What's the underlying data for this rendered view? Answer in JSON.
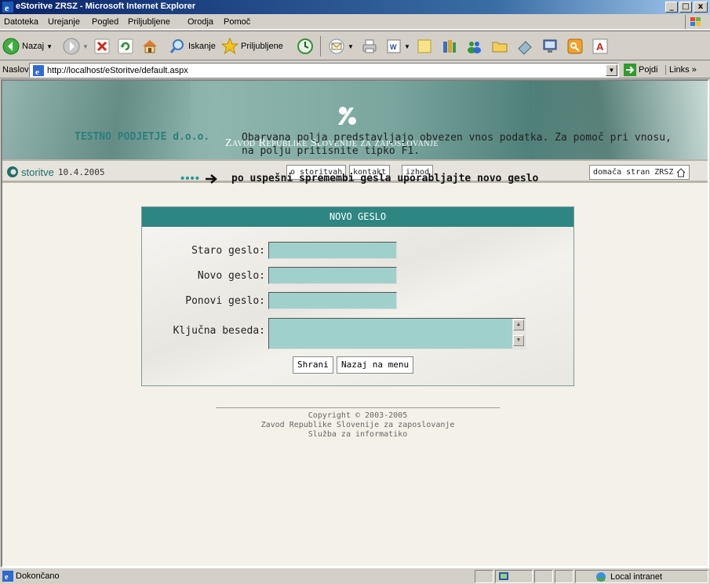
{
  "window": {
    "title": "eStoritve ZRSZ - Microsoft Internet Explorer",
    "controls": [
      "_",
      "□",
      "x"
    ]
  },
  "menu": [
    "Datoteka",
    "Urejanje",
    "Pogled",
    "Priljubljene",
    "Orodja",
    "Pomoč"
  ],
  "toolbar": {
    "back_label": "Nazaj",
    "search_label": "Iskanje",
    "favorites_label": "Priljubljene"
  },
  "address": {
    "label": "Naslov",
    "url": "http://localhost/eStoritve/default.aspx",
    "go_label": "Pojdi",
    "links_label": "Links »"
  },
  "banner": {
    "org": "Zavod Republike Slovenije za zaposlovanje"
  },
  "nav": {
    "brand": "storitve",
    "date": "10.4.2005",
    "links": [
      "o storitvah",
      "kontakt",
      "izhod"
    ],
    "home_link": "domača stran ZRSZ"
  },
  "page": {
    "company": "TESTNO PODJETJE d.o.o.",
    "instructions": "Obarvana polja predstavljajo obvezen vnos podatka. Za pomoč pri vnosu, na polju pritisnite tipko F1.",
    "tip_dots": "••••",
    "tip": "po uspešni spremembi gesla uporabljajte novo geslo"
  },
  "form": {
    "header": "NOVO GESLO",
    "fields": [
      {
        "label": "Staro geslo:",
        "value": ""
      },
      {
        "label": "Novo geslo:",
        "value": ""
      },
      {
        "label": "Ponovi geslo:",
        "value": ""
      }
    ],
    "keyword_label": "Ključna beseda:",
    "save_label": "Shrani",
    "back_label": "Nazaj na menu"
  },
  "footer": {
    "line1": "Copyright © 2003-2005",
    "line2": "Zavod Republike Slovenije za zaposlovanje",
    "line3": "Služba za informatiko"
  },
  "status": {
    "text": "Dokončano",
    "zone": "Local intranet"
  },
  "colors": {
    "accent": "#2e8682",
    "field_bg": "#9fd0cc",
    "company_text": "#2b7f7b"
  }
}
